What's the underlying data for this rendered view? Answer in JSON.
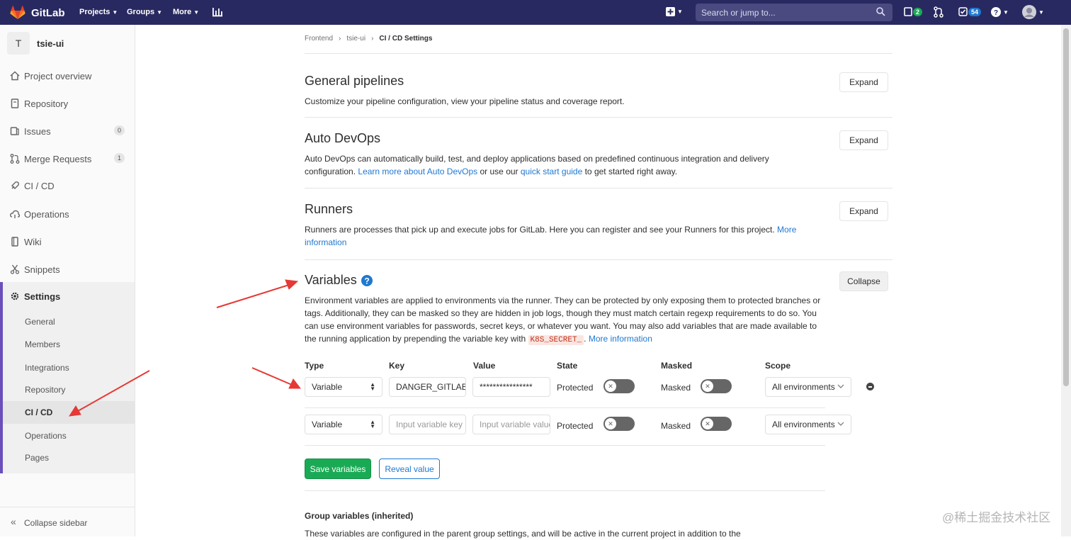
{
  "topbar": {
    "brand": "GitLab",
    "nav": [
      {
        "label": "Projects"
      },
      {
        "label": "Groups"
      },
      {
        "label": "More"
      }
    ],
    "search_placeholder": "Search or jump to...",
    "todos_count": "2",
    "issues_count": "54"
  },
  "sidebar": {
    "project_initial": "T",
    "project_name": "tsie-ui",
    "items": [
      {
        "label": "Project overview"
      },
      {
        "label": "Repository"
      },
      {
        "label": "Issues",
        "count": "0"
      },
      {
        "label": "Merge Requests",
        "count": "1"
      },
      {
        "label": "CI / CD"
      },
      {
        "label": "Operations"
      },
      {
        "label": "Wiki"
      },
      {
        "label": "Snippets"
      },
      {
        "label": "Settings"
      }
    ],
    "settings_sub": [
      "General",
      "Members",
      "Integrations",
      "Repository",
      "CI / CD",
      "Operations",
      "Pages"
    ],
    "collapse_label": "Collapse sidebar"
  },
  "breadcrumb": [
    "Frontend",
    "tsie-ui",
    "CI / CD Settings"
  ],
  "sections": {
    "general": {
      "title": "General pipelines",
      "desc": "Customize your pipeline configuration, view your pipeline status and coverage report.",
      "button": "Expand"
    },
    "autodevops": {
      "title": "Auto DevOps",
      "desc_1": "Auto DevOps can automatically build, test, and deploy applications based on predefined continuous integration and delivery configuration. ",
      "link_1": "Learn more about Auto DevOps",
      "desc_2": " or use our ",
      "link_2": "quick start guide",
      "desc_3": " to get started right away.",
      "button": "Expand"
    },
    "runners": {
      "title": "Runners",
      "desc": "Runners are processes that pick up and execute jobs for GitLab. Here you can register and see your Runners for this project. ",
      "link": "More information",
      "button": "Expand"
    },
    "variables": {
      "title": "Variables",
      "desc": "Environment variables are applied to environments via the runner. They can be protected by only exposing them to protected branches or tags. Additionally, they can be masked so they are hidden in job logs, though they must match certain regexp requirements to do so. You can use environment variables for passwords, secret keys, or whatever you want. You may also add variables that are made available to the running application by prepending the variable key with ",
      "code": "K8S_SECRET_",
      "desc_end": ". ",
      "link": "More information",
      "button": "Collapse",
      "columns": [
        "Type",
        "Key",
        "Value",
        "State",
        "Masked",
        "Scope"
      ],
      "rows": [
        {
          "type": "Variable",
          "key": "DANGER_GITLAB",
          "value": "****************",
          "protected_label": "Protected",
          "masked_label": "Masked",
          "scope": "All environments"
        },
        {
          "type": "Variable",
          "key_placeholder": "Input variable key",
          "value_placeholder": "Input variable value",
          "protected_label": "Protected",
          "masked_label": "Masked",
          "scope": "All environments"
        }
      ],
      "save_button": "Save variables",
      "reveal_button": "Reveal value"
    },
    "group_vars": {
      "title": "Group variables (inherited)",
      "desc": "These variables are configured in the parent group settings, and will be active in the current project in addition to the"
    }
  },
  "watermark": "@稀土掘金技术社区",
  "colors": {
    "navbar": "#292961",
    "accent": "#6b4fbb",
    "link": "#1f78d1",
    "success": "#1aaa55",
    "arrow": "#e53935"
  }
}
